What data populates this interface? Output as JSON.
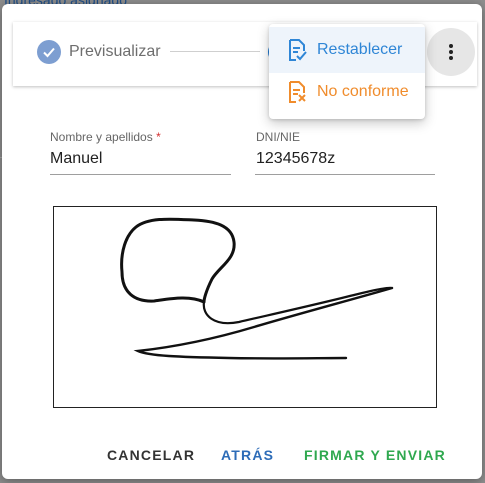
{
  "background": {
    "text": "Ingresado asignado"
  },
  "stepper": {
    "step1_label": "Previsualizar"
  },
  "menu": {
    "items": [
      {
        "label": "Restablecer",
        "icon": "document-check-icon",
        "color": "#2f86d6"
      },
      {
        "label": "No conforme",
        "icon": "document-x-icon",
        "color": "#f08c2c"
      }
    ]
  },
  "form": {
    "name_label": "Nombre y apellidos",
    "name_required_mark": "*",
    "name_value": "Manuel",
    "dni_label": "DNI/NIE",
    "dni_value": "12345678z"
  },
  "actions": {
    "cancel": "CANCELAR",
    "back": "ATRÁS",
    "sign": "FIRMAR Y ENVIAR"
  },
  "colors": {
    "primary": "#1976d2",
    "success": "#2fa84f",
    "step_done": "#7d9ed1"
  }
}
